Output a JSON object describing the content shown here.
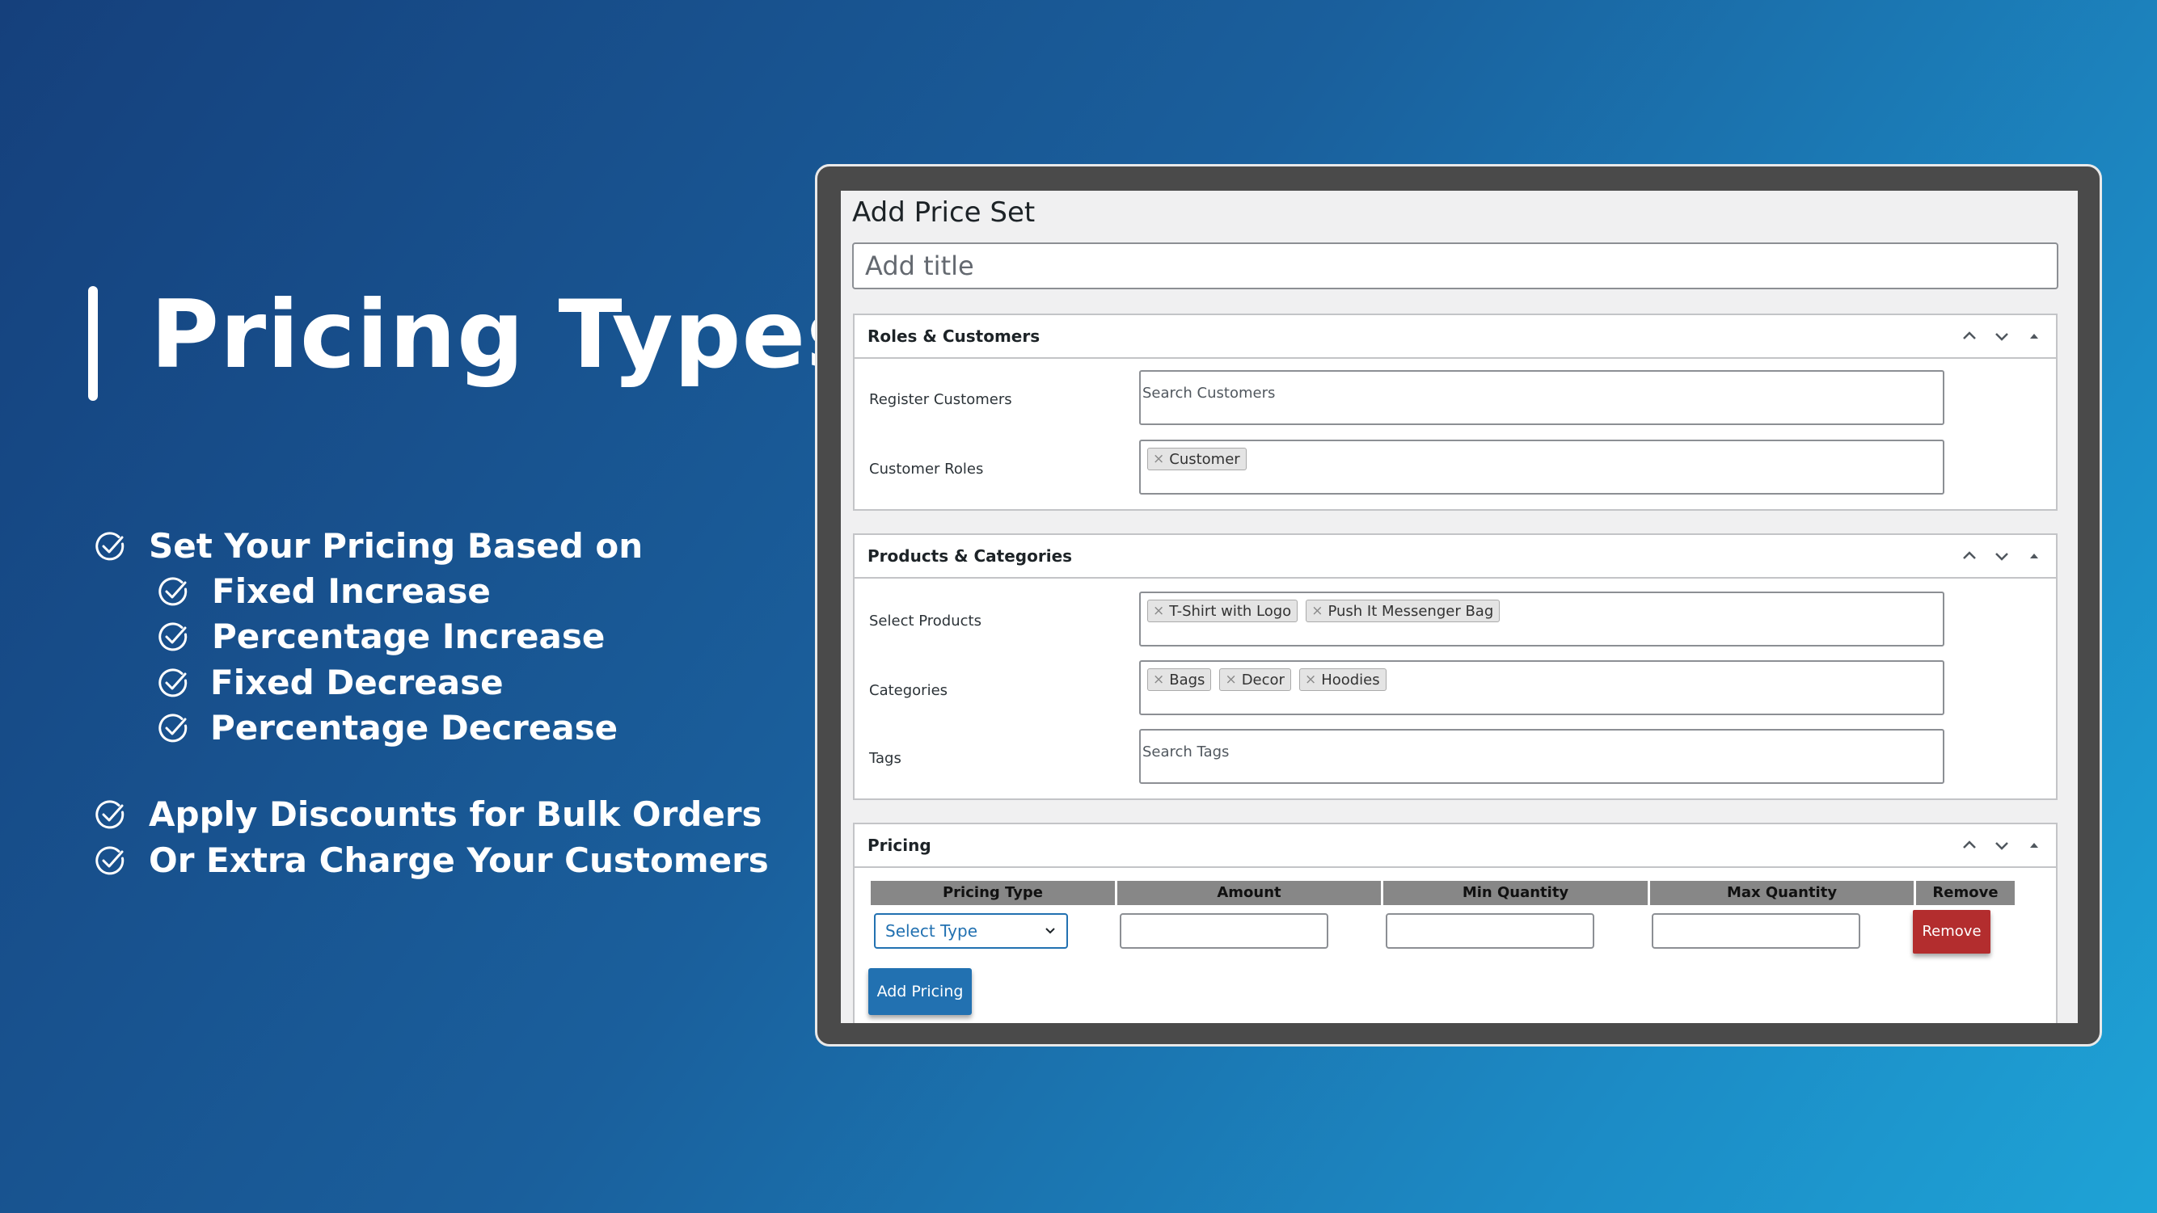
{
  "hero": {
    "title": "Pricing Types",
    "features": [
      "Set Your Pricing Based on",
      "Fixed Increase",
      "Percentage Increase",
      "Fixed Decrease",
      "Percentage Decrease",
      "Apply Discounts for Bulk Orders",
      "Or Extra Charge Your Customers"
    ]
  },
  "screen": {
    "page_title": "Add Price Set",
    "title_placeholder": "Add title",
    "roles_box": {
      "title": "Roles & Customers",
      "register_label": "Register Customers",
      "register_placeholder": "Search Customers",
      "roles_label": "Customer Roles",
      "roles_chips": [
        "Customer"
      ]
    },
    "products_box": {
      "title": "Products & Categories",
      "products_label": "Select Products",
      "product_chips": [
        "T-Shirt with Logo",
        "Push It Messenger Bag"
      ],
      "categories_label": "Categories",
      "category_chips": [
        "Bags",
        "Decor",
        "Hoodies"
      ],
      "tags_label": "Tags",
      "tags_placeholder": "Search Tags"
    },
    "pricing_box": {
      "title": "Pricing",
      "columns": [
        "Pricing Type",
        "Amount",
        "Min Quantity",
        "Max Quantity",
        "Remove"
      ],
      "select_value": "Select Type",
      "remove_label": "Remove",
      "add_label": "Add Pricing"
    },
    "chip_remove_glyph": "×"
  },
  "colors": {
    "accent_blue": "#2271b1",
    "danger_red": "#b32d2e",
    "table_header_gray": "#878787"
  },
  "icons": [
    "check-circle-icon",
    "chevron-up-icon",
    "chevron-down-icon",
    "collapse-arrow-icon"
  ]
}
